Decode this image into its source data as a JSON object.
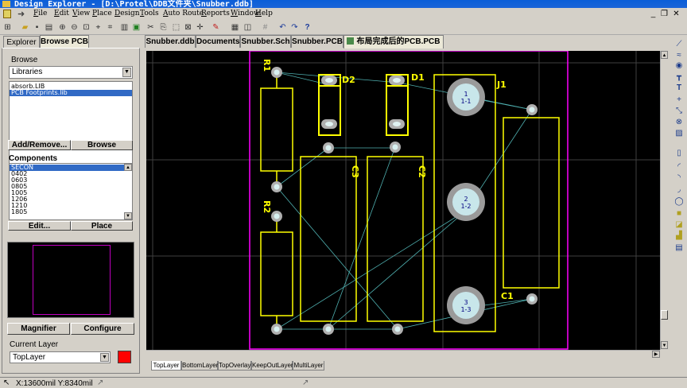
{
  "window": {
    "title": "Design Explorer - [D:\\Protel\\DDB文件夹\\Snubber.ddb]"
  },
  "menu": [
    "File",
    "Edit",
    "View",
    "Place",
    "Design",
    "Tools",
    "Auto Route",
    "Reports",
    "Window",
    "Help"
  ],
  "panel": {
    "tabs": [
      "Explorer",
      "Browse PCB"
    ],
    "browse_label": "Browse",
    "browse_value": "Libraries",
    "libraries": [
      {
        "label": "absorb.LIB",
        "selected": false
      },
      {
        "label": "PCB Footprints.lib",
        "selected": true
      }
    ],
    "add_remove_label": "Add/Remove...",
    "browse_button_label": "Browse",
    "components_label": "Components",
    "components": [
      {
        "label": "SECON",
        "selected": true
      },
      {
        "label": "0402",
        "selected": false
      },
      {
        "label": "0603",
        "selected": false
      },
      {
        "label": "0805",
        "selected": false
      },
      {
        "label": "1005",
        "selected": false
      },
      {
        "label": "1206",
        "selected": false
      },
      {
        "label": "1210",
        "selected": false
      },
      {
        "label": "1805",
        "selected": false
      }
    ],
    "edit_label": "Edit...",
    "place_label": "Place",
    "magnifier_label": "Magnifier",
    "configure_label": "Configure",
    "current_layer_label": "Current Layer",
    "current_layer_value": "TopLayer",
    "current_layer_color": "#ff0000"
  },
  "doc_tabs": [
    {
      "label": "Snubber.ddb",
      "active": false
    },
    {
      "label": "Documents",
      "active": false
    },
    {
      "label": "Snubber.Sch",
      "active": false
    },
    {
      "label": "Snubber.PCB",
      "active": false
    },
    {
      "label": "布局完成后的PCB.PCB",
      "active": true
    }
  ],
  "layer_tabs": [
    {
      "label": "TopLayer",
      "active": true
    },
    {
      "label": "BottomLayer",
      "active": false
    },
    {
      "label": "TopOverlay",
      "active": false
    },
    {
      "label": "KeepOutLayer",
      "active": false
    },
    {
      "label": "MultiLayer",
      "active": false
    }
  ],
  "pcb": {
    "colors": {
      "board": "#000000",
      "overlay": "#ffff00",
      "keepout": "#ff00ff",
      "grid": "#404040",
      "pad": "#c0c0c0",
      "rats": "#4fb0b0",
      "pad_label": "#000080"
    },
    "designators": {
      "R1": "R1",
      "R2": "R2",
      "D2": "D2",
      "D1": "D1",
      "C3": "C3",
      "C2": "C2",
      "J1": "J1",
      "C1": "C1"
    },
    "j1_pads": [
      {
        "num": "1",
        "label": "1-1"
      },
      {
        "num": "2",
        "label": "1-2"
      },
      {
        "num": "3",
        "label": "1-3"
      }
    ]
  },
  "status": {
    "coords": "X:13600mil Y:8340mil"
  }
}
